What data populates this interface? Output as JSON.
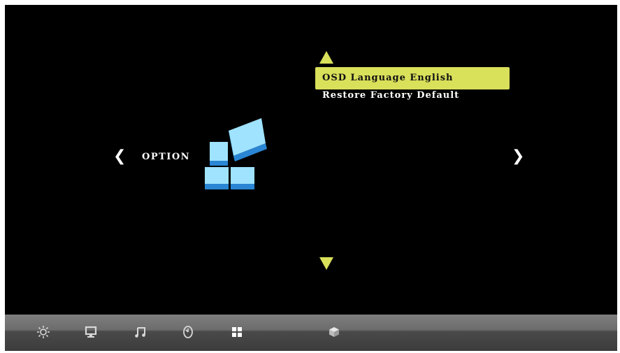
{
  "menu": {
    "category": "OPTION",
    "items": [
      {
        "label": "OSD Language English",
        "selected": true
      },
      {
        "label": "Restore Factory Default",
        "selected": false
      }
    ]
  },
  "nav": {
    "left": "❮",
    "right": "❯"
  },
  "taskbar": {
    "icons": [
      "picture-settings-icon",
      "screen-icon",
      "sound-icon",
      "time-icon",
      "option-icon",
      "lock-icon"
    ],
    "active_index": 4
  },
  "colors": {
    "background": "#000000",
    "highlight": "#d9e05a",
    "icon_blue": "#9fe3ff",
    "taskbar": "#6c6c6c"
  }
}
